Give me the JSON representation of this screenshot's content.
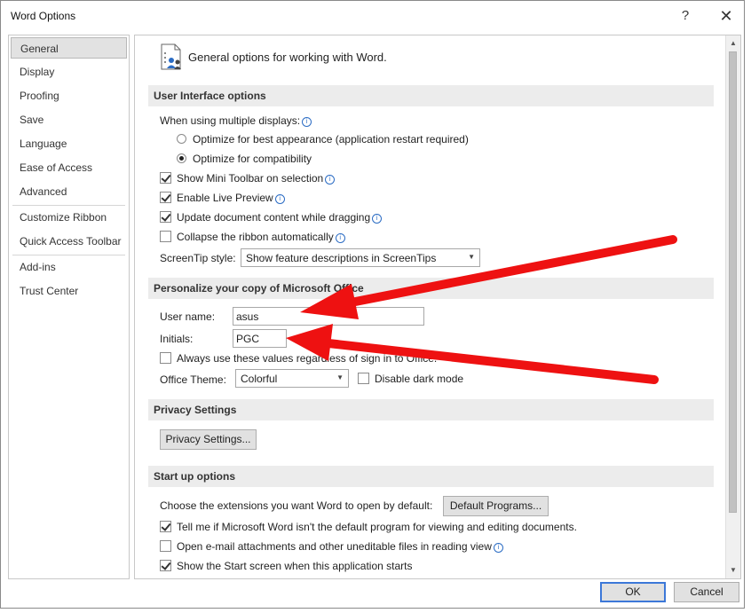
{
  "window": {
    "title": "Word Options",
    "help_glyph": "?",
    "close_glyph": "✕"
  },
  "nav": {
    "items": [
      {
        "label": "General",
        "selected": true
      },
      {
        "label": "Display"
      },
      {
        "label": "Proofing"
      },
      {
        "label": "Save"
      },
      {
        "label": "Language"
      },
      {
        "label": "Ease of Access"
      },
      {
        "label": "Advanced"
      },
      {
        "label": "Customize Ribbon"
      },
      {
        "label": "Quick Access Toolbar"
      },
      {
        "label": "Add-ins"
      },
      {
        "label": "Trust Center"
      }
    ]
  },
  "header": {
    "text": "General options for working with Word."
  },
  "ui_options": {
    "title": "User Interface options",
    "multiple_displays_label": "When using multiple displays:",
    "radio_best": "Optimize for best appearance (application restart required)",
    "radio_compat": "Optimize for compatibility",
    "mini_toolbar": "Show Mini Toolbar on selection",
    "live_preview": "Enable Live Preview",
    "update_dragging": "Update document content while dragging",
    "collapse_ribbon": "Collapse the ribbon automatically",
    "screentip_label": "ScreenTip style:",
    "screentip_value": "Show feature descriptions in ScreenTips"
  },
  "personalize": {
    "title": "Personalize your copy of Microsoft Office",
    "username_label": "User name:",
    "username_value": "asus",
    "initials_label": "Initials:",
    "initials_value": "PGC",
    "always_use": "Always use these values regardless of sign in to Office.",
    "theme_label": "Office Theme:",
    "theme_value": "Colorful",
    "dark_mode": "Disable dark mode"
  },
  "privacy": {
    "title": "Privacy Settings",
    "button": "Privacy Settings..."
  },
  "startup": {
    "title": "Start up options",
    "extensions_label": "Choose the extensions you want Word to open by default:",
    "default_programs": "Default Programs...",
    "tell_me": "Tell me if Microsoft Word isn't the default program for viewing and editing documents.",
    "open_email": "Open e-mail attachments and other uneditable files in reading view",
    "show_start": "Show the Start screen when this application starts"
  },
  "footer": {
    "ok": "OK",
    "cancel": "Cancel"
  },
  "info_glyph": "i",
  "colors": {
    "annotation_arrow": "#ee1111",
    "accent": "#3c78d8",
    "section_band": "#ececec"
  }
}
